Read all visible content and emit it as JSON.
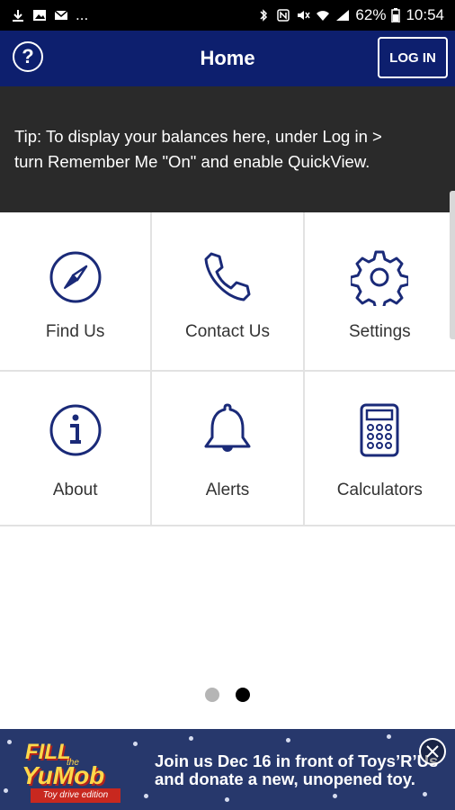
{
  "status_bar": {
    "battery": "62%",
    "time": "10:54",
    "dots": "...",
    "icons": [
      "download-icon",
      "image-icon",
      "mail-icon",
      "bluetooth-icon",
      "nfc-icon",
      "mute-icon",
      "wifi-icon",
      "signal-icon",
      "battery-icon"
    ]
  },
  "header": {
    "help_label": "?",
    "title": "Home",
    "login_label": "LOG IN"
  },
  "tip": {
    "line1": "Tip: To display your balances here, under Log in >",
    "line2": "turn Remember Me \"On\" and enable QuickView."
  },
  "tiles": [
    {
      "label": "Find Us",
      "icon": "compass-icon"
    },
    {
      "label": "Contact Us",
      "icon": "phone-icon"
    },
    {
      "label": "Settings",
      "icon": "gear-icon"
    },
    {
      "label": "About",
      "icon": "info-icon"
    },
    {
      "label": "Alerts",
      "icon": "bell-icon"
    },
    {
      "label": "Calculators",
      "icon": "calculator-icon"
    }
  ],
  "pager": {
    "pages": 2,
    "active_page": 2
  },
  "ad": {
    "logo_fill": "FILL",
    "logo_the": "the",
    "logo_yumob": "YuMob",
    "logo_tag": "Toy drive edition",
    "line1": "Join us Dec 16 in front of Toys’R’Us",
    "line2": "and donate a new, unopened toy."
  },
  "colors": {
    "header_bg": "#0d1f6e",
    "icon_blue": "#1a2a78",
    "tip_bg": "#2a2a2a",
    "ad_bg": "#27386c"
  }
}
